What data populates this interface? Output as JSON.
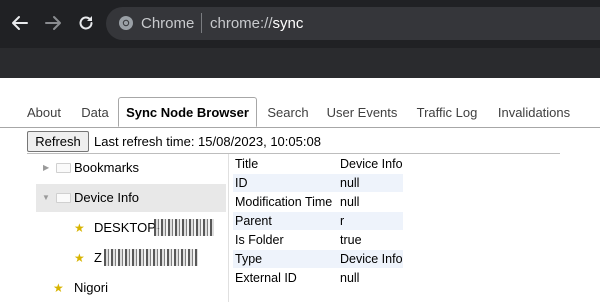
{
  "browser": {
    "site_name": "Chrome",
    "url_prefix": "chrome://",
    "url_host": "sync"
  },
  "tabs": [
    {
      "label": "About"
    },
    {
      "label": "Data"
    },
    {
      "label": "Sync Node Browser",
      "active": true
    },
    {
      "label": "Search"
    },
    {
      "label": "User Events"
    },
    {
      "label": "Traffic Log"
    },
    {
      "label": "Invalidations"
    }
  ],
  "toolbar": {
    "refresh_label": "Refresh",
    "last_refresh_text": "Last refresh time: 15/08/2023, 10:05:08"
  },
  "tree": {
    "bookmarks": "Bookmarks",
    "device_info": "Device Info",
    "device_1_prefix": "DESKTOP-",
    "device_2_prefix": "Z",
    "nigori": "Nigori"
  },
  "details": [
    {
      "key": "Title",
      "value": "Device Info"
    },
    {
      "key": "ID",
      "value": "null"
    },
    {
      "key": "Modification Time",
      "value": "null"
    },
    {
      "key": "Parent",
      "value": "r"
    },
    {
      "key": "Is Folder",
      "value": "true"
    },
    {
      "key": "Type",
      "value": "Device Info"
    },
    {
      "key": "External ID",
      "value": "null"
    }
  ],
  "colors": {
    "chrome_dark": "#202124",
    "omnibox": "#35363a",
    "selected_row": "#e8e8e8",
    "detail_shade": "#eef3fb",
    "star": "#d8b400"
  }
}
